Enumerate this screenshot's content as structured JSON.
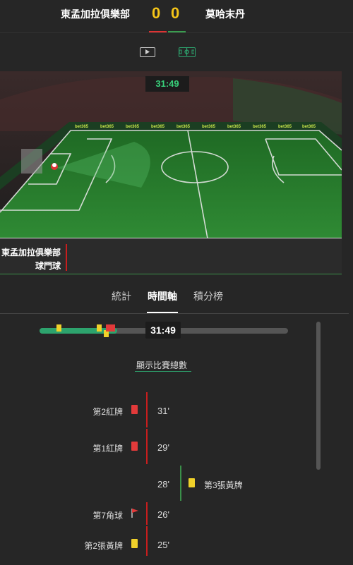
{
  "header": {
    "home_team": "東孟加拉俱樂部",
    "away_team": "莫哈末丹",
    "home_score": "0",
    "away_score": "0"
  },
  "icons": {
    "video": "play-icon",
    "pitch": "pitch-view-icon",
    "corner": "corner-flag-icon"
  },
  "pitch": {
    "clock": "31:49",
    "ad_text": "bet365"
  },
  "event_panel": {
    "team": "東孟加拉俱樂部",
    "event": "球門球"
  },
  "tabs": [
    {
      "label": "統計"
    },
    {
      "label": "時間軸"
    },
    {
      "label": "積分榜"
    }
  ],
  "timeline": {
    "current_time": "31:49",
    "show_total": "顯示比賽總數"
  },
  "events": [
    {
      "side": "home",
      "label": "第2紅牌",
      "minute": "31'",
      "type": "red-card"
    },
    {
      "side": "home",
      "label": "第1紅牌",
      "minute": "29'",
      "type": "red-card"
    },
    {
      "side": "away",
      "label": "第3張黃牌",
      "minute": "28'",
      "type": "yellow-card"
    },
    {
      "side": "home",
      "label": "第7角球",
      "minute": "26'",
      "type": "corner"
    },
    {
      "side": "home",
      "label": "第2張黃牌",
      "minute": "25'",
      "type": "yellow-card"
    }
  ],
  "colors": {
    "home": "#c81e1e",
    "away": "#3a8f49",
    "score": "#f5c518",
    "accent": "#2da36d"
  }
}
